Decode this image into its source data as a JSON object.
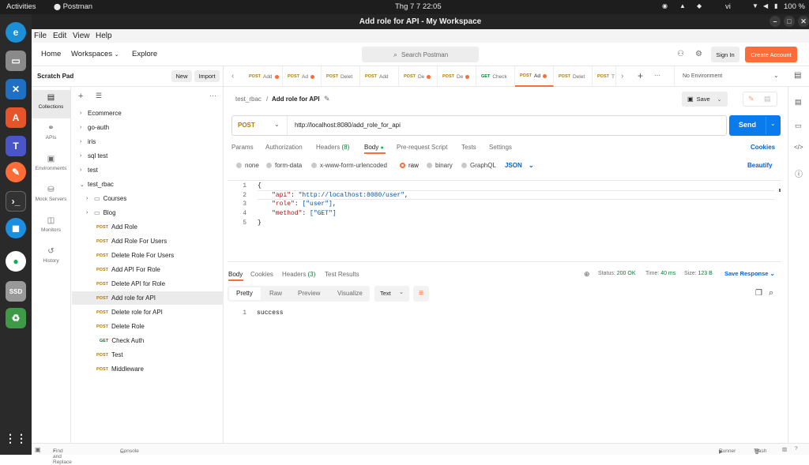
{
  "gnome": {
    "activities": "Activities",
    "app": "Postman",
    "datetime": "Thg 7 7  22:05",
    "lang": "vi",
    "battery": "100 %"
  },
  "window": {
    "title": "Add role for API - My Workspace"
  },
  "menu": [
    "File",
    "Edit",
    "View",
    "Help"
  ],
  "header": {
    "home": "Home",
    "workspaces": "Workspaces",
    "explore": "Explore",
    "search_placeholder": "Search Postman",
    "sign_in": "Sign In",
    "create_account": "Create Account"
  },
  "scratch": {
    "title": "Scratch Pad",
    "new": "New",
    "import": "Import"
  },
  "rail": [
    {
      "label": "Collections",
      "icon": "trash-can-icon"
    },
    {
      "label": "APIs",
      "icon": "apis-icon"
    },
    {
      "label": "Environments",
      "icon": "environments-icon"
    },
    {
      "label": "Mock Servers",
      "icon": "mock-server-icon"
    },
    {
      "label": "Monitors",
      "icon": "monitor-icon"
    },
    {
      "label": "History",
      "icon": "history-icon"
    }
  ],
  "tree": [
    {
      "label": "Ecommerce",
      "type": "collection"
    },
    {
      "label": "go-auth",
      "type": "collection"
    },
    {
      "label": "iris",
      "type": "collection"
    },
    {
      "label": "sql test",
      "type": "collection"
    },
    {
      "label": "test",
      "type": "collection"
    },
    {
      "label": "test_rbac",
      "type": "collection-open"
    },
    {
      "label": "Courses",
      "type": "folder"
    },
    {
      "label": "Blog",
      "type": "folder"
    },
    {
      "label": "Add Role",
      "method": "POST"
    },
    {
      "label": "Add Role For Users",
      "method": "POST"
    },
    {
      "label": "Delete Role For Users",
      "method": "POST"
    },
    {
      "label": "Add API For Role",
      "method": "POST"
    },
    {
      "label": "Delete API for Role",
      "method": "POST"
    },
    {
      "label": "Add role for API",
      "method": "POST",
      "selected": true
    },
    {
      "label": "Delete role for API",
      "method": "POST"
    },
    {
      "label": "Delete Role",
      "method": "POST"
    },
    {
      "label": "Check Auth",
      "method": "GET"
    },
    {
      "label": "Test",
      "method": "POST"
    },
    {
      "label": "Middleware",
      "method": "POST"
    }
  ],
  "tabs": [
    {
      "method": "POST",
      "label": "Add"
    },
    {
      "method": "POST",
      "label": "Ad"
    },
    {
      "method": "POST",
      "label": "Delet"
    },
    {
      "method": "POST",
      "label": "Add"
    },
    {
      "method": "POST",
      "label": "De"
    },
    {
      "method": "POST",
      "label": "De"
    },
    {
      "method": "GET",
      "label": "Check"
    },
    {
      "method": "POST",
      "label": "Ad",
      "selected": true
    },
    {
      "method": "POST",
      "label": "Delet"
    },
    {
      "method": "POST",
      "label": "T"
    }
  ],
  "environment": "No Environment",
  "request": {
    "breadcrumb_parent": "test_rbac",
    "breadcrumb_sep": "/",
    "name": "Add role for API",
    "save": "Save",
    "method": "POST",
    "url": "http://localhost:8080/add_role_for_api",
    "send": "Send",
    "tabs": [
      "Params",
      "Authorization",
      "Headers",
      "Body",
      "Pre-request Script",
      "Tests",
      "Settings"
    ],
    "headers_count": "(8)",
    "cookies": "Cookies",
    "body_types": [
      "none",
      "form-data",
      "x-www-form-urlencoded",
      "raw",
      "binary",
      "GraphQL"
    ],
    "format": "JSON",
    "beautify": "Beautify",
    "code_lines": [
      {
        "n": "1",
        "text": "{"
      },
      {
        "n": "2",
        "key": "\"api\"",
        "value": "\"http://localhost:8080/user\"",
        "tail": ","
      },
      {
        "n": "3",
        "key": "\"role\"",
        "value": "[\"user\"]",
        "tail": ","
      },
      {
        "n": "4",
        "key": "\"method\"",
        "value": "[\"GET\"]",
        "tail": ""
      },
      {
        "n": "5",
        "text": "}"
      }
    ]
  },
  "response": {
    "tabs": [
      "Body",
      "Cookies",
      "Headers",
      "Test Results"
    ],
    "headers_count": "(3)",
    "status_label": "Status:",
    "status": "200 OK",
    "time_label": "Time:",
    "time": "40 ms",
    "size_label": "Size:",
    "size": "123 B",
    "save_response": "Save Response",
    "views": [
      "Pretty",
      "Raw",
      "Preview",
      "Visualize"
    ],
    "format": "Text",
    "line": "1",
    "body": "success"
  },
  "statusbar": {
    "find": "Find and Replace",
    "console": "Console",
    "runner": "Runner",
    "trash": "Trash"
  },
  "colors": {
    "accent": "#ff6c37",
    "send": "#097bed",
    "post": "#ad7a03",
    "get": "#007f31",
    "status_ok": "#007f31"
  }
}
